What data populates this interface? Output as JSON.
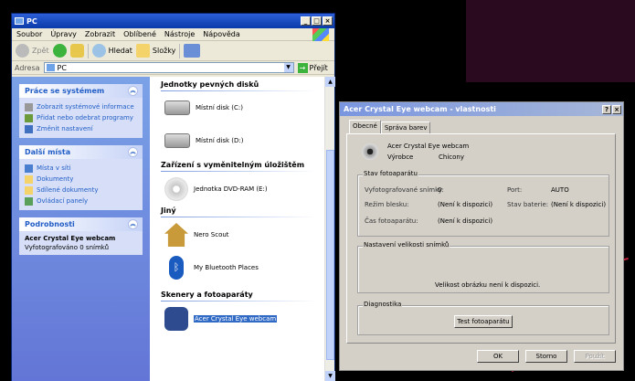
{
  "explorer": {
    "title": "PC",
    "menu": [
      "Soubor",
      "Úpravy",
      "Zobrazit",
      "Oblíbené",
      "Nástroje",
      "Nápověda"
    ],
    "toolbar": {
      "back": "Zpět",
      "search": "Hledat",
      "folders": "Složky"
    },
    "address": {
      "label": "Adresa",
      "value": "PC",
      "go": "Přejít"
    },
    "panels": {
      "system": {
        "title": "Práce se systémem",
        "items": [
          "Zobrazit systémové informace",
          "Přidat nebo odebrat programy",
          "Změnit nastavení"
        ]
      },
      "places": {
        "title": "Další místa",
        "items": [
          "Místa v síti",
          "Dokumenty",
          "Sdílené dokumenty",
          "Ovládací panely"
        ]
      },
      "details": {
        "title": "Podrobnosti",
        "name": "Acer Crystal Eye webcam",
        "text": "Vyfotografováno 0 snímků"
      }
    },
    "groups": {
      "hdd": {
        "title": "Jednotky pevných disků",
        "items": [
          "Místní disk (C:)",
          "Místní disk (D:)"
        ]
      },
      "removable": {
        "title": "Zařízení s vyměnitelným úložištěm",
        "items": [
          "Jednotka DVD-RAM (E:)"
        ]
      },
      "other": {
        "title": "Jiný",
        "items": [
          "Nero Scout",
          "My Bluetooth Places"
        ]
      },
      "scanners": {
        "title": "Skenery a fotoaparáty",
        "items": [
          "Acer Crystal Eye webcam"
        ]
      }
    }
  },
  "dialog": {
    "title": "Acer Crystal Eye webcam - vlastnosti",
    "tabs": [
      "Obecné",
      "Správa barev"
    ],
    "device_name": "Acer Crystal Eye webcam",
    "vendor_label": "Výrobce",
    "vendor_value": "Chicony",
    "status": {
      "legend": "Stav fotoaparátu",
      "photos_label": "Vyfotografované snímky:",
      "photos_value": "0",
      "port_label": "Port:",
      "port_value": "AUTO",
      "flash_label": "Režim blesku:",
      "flash_value": "(Není k dispozici)",
      "battery_label": "Stav baterie:",
      "battery_value": "(Není k dispozici)",
      "time_label": "Čas fotoaparátu:",
      "time_value": "(Není k dispozici)"
    },
    "size": {
      "legend": "Nastavení velikosti snímků",
      "message": "Velikost obrázku není k dispozici."
    },
    "diagnostics": {
      "legend": "Diagnostika",
      "test_button": "Test fotoaparátu"
    },
    "buttons": {
      "ok": "OK",
      "cancel": "Storno",
      "apply": "Použít"
    }
  }
}
